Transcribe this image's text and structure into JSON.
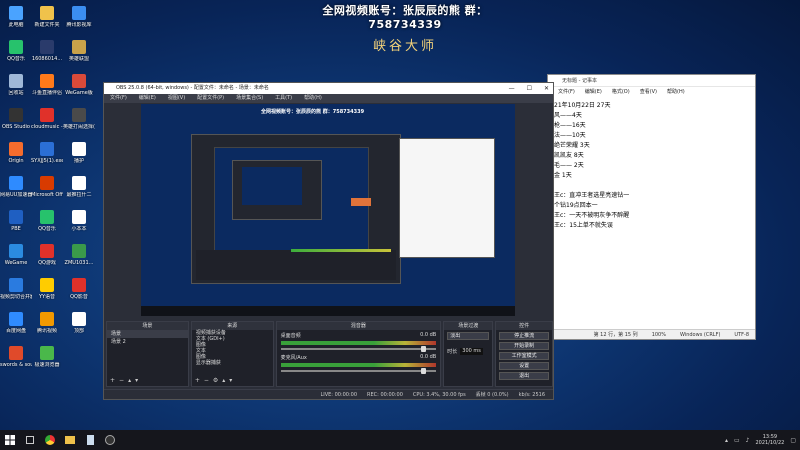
{
  "overlay": {
    "line1": "全网视频账号：张辰辰的熊  群：758734339",
    "line2": "峡谷大师"
  },
  "desktop_icons": [
    {
      "label": "此电脑",
      "color": "#4aa3ff"
    },
    {
      "label": "新建文件夹",
      "color": "#f0c24b"
    },
    {
      "label": "腾讯影视库",
      "color": "#3b8ef0"
    },
    {
      "label": "QQ音乐",
      "color": "#27c26c"
    },
    {
      "label": "16086014...",
      "color": "#2a3b6b"
    },
    {
      "label": "英雄联盟",
      "color": "#c9a24a"
    },
    {
      "label": "回收站",
      "color": "#9fb8d8"
    },
    {
      "label": "斗鱼直播伴侣",
      "color": "#ff7a1a"
    },
    {
      "label": "WeGame版",
      "color": "#d94a3a"
    },
    {
      "label": "OBS Studio",
      "color": "#333333"
    },
    {
      "label": "cloudmusic - 快捷方式",
      "color": "#e0312a"
    },
    {
      "label": "英雄打闹选择(7.12版本)",
      "color": "#4a4a4a"
    },
    {
      "label": "Origin",
      "color": "#f56c2d"
    },
    {
      "label": "SYXJJ5(1).exe",
      "color": "#2b6fd6"
    },
    {
      "label": "播护",
      "color": "#ffffff"
    },
    {
      "label": "网易UU加速器",
      "color": "#2e8bff"
    },
    {
      "label": "Microsoft Office",
      "color": "#d83b01"
    },
    {
      "label": "最推拉什二",
      "color": "#ffffff"
    },
    {
      "label": "PBE",
      "color": "#1f5fc2"
    },
    {
      "label": "QQ音乐",
      "color": "#27c26c"
    },
    {
      "label": "小本本",
      "color": "#ffffff"
    },
    {
      "label": "WeGame",
      "color": "#2b8be0"
    },
    {
      "label": "QQ游戏",
      "color": "#e0312a"
    },
    {
      "label": "ZMU1031...",
      "color": "#3a9a4a"
    },
    {
      "label": "视频剪切合并器",
      "color": "#2a7be0"
    },
    {
      "label": "YY语音",
      "color": "#ffcc00"
    },
    {
      "label": "QQ影音",
      "color": "#e0312a"
    },
    {
      "label": "百度网盘",
      "color": "#2f8bff"
    },
    {
      "label": "腾讯视频",
      "color": "#f29900"
    },
    {
      "label": "顶部",
      "color": "#ffffff"
    },
    {
      "label": "swords & souls ne...",
      "color": "#e04a2a"
    },
    {
      "label": "极速浏览器",
      "color": "#4ab84a"
    }
  ],
  "notepad": {
    "title": "无标题 - 记事本",
    "menu": [
      "文件(F)",
      "编辑(E)",
      "格式(O)",
      "查看(V)",
      "帮助(H)"
    ],
    "lines": [
      "21年10月22日          27天",
      "风——4天",
      "枪——16天",
      "法——10天",
      "绝芒荣耀        3天",
      "凯凯友          8天",
      "毛——          2天",
      "金              1天",
      "",
      "王c：直冲王者选星亮速钻一",
      "个钻19点回本一",
      "王c：一天不被明灰争不醉醒",
      "王c：15上单不就失误"
    ],
    "status": [
      "第 12 行，第 15 列",
      "100%",
      "Windows (CRLF)",
      "UTF-8"
    ]
  },
  "obs": {
    "title": "OBS 25.0.8 (64-bit, windows) - 配置文件：未命名 - 场景：未命名",
    "menu": [
      "文件(F)",
      "编辑(E)",
      "视图(V)",
      "配置文件(P)",
      "场景集合(S)",
      "工具(T)",
      "帮助(H)"
    ],
    "preview_text": "全网视频账号：张辰辰的熊  群：758734339",
    "docks": {
      "scenes_title": "场景",
      "scenes": [
        "场景",
        "场景 2"
      ],
      "sources_title": "来源",
      "sources": [
        "视频捕获设备",
        "文本 (GDI+)",
        "图像",
        "文本",
        "图像",
        "显示器捕获",
        "窗口捕获",
        "显示器捕获 2"
      ],
      "mixer_title": "混音器",
      "mixer": [
        {
          "name": "桌面音频",
          "db": "0.0 dB"
        },
        {
          "name": "麦克风/Aux",
          "db": "0.0 dB"
        }
      ],
      "transitions_title": "场景过渡",
      "transition_name": "淡出",
      "duration_label": "时长",
      "duration_value": "300 ms",
      "controls_title": "控件",
      "controls": [
        "停止推流",
        "开始录制",
        "工作室模式",
        "设置",
        "退出"
      ]
    },
    "status": [
      "LIVE: 00:00:00",
      "REC: 00:00:00",
      "CPU: 3.4%, 30.00 fps",
      "丢帧 0 (0.0%)",
      "kb/s: 2516"
    ]
  },
  "taskbar": {
    "time": "13:59",
    "date": "2021/10/22"
  }
}
